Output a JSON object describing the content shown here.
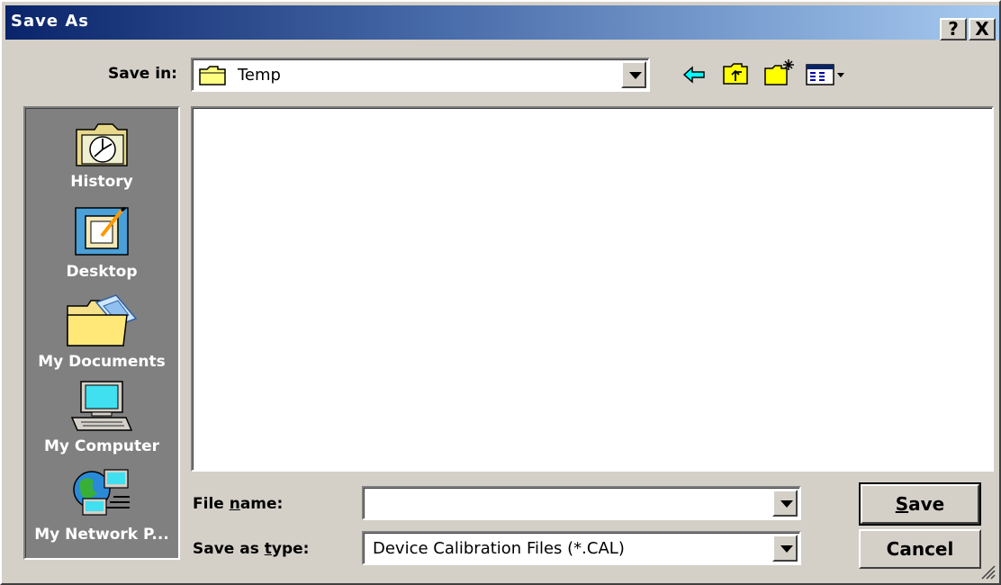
{
  "window": {
    "title": "Save As",
    "help_button": "?",
    "close_button": "X"
  },
  "save_in": {
    "label": "Save in:",
    "value": "Temp"
  },
  "toolbar": {
    "back_icon": "arrow-left-icon",
    "up_icon": "folder-up-icon",
    "new_folder_icon": "new-folder-icon",
    "view_icon": "view-menu-icon"
  },
  "places": [
    {
      "label": "History",
      "icon": "history-icon"
    },
    {
      "label": "Desktop",
      "icon": "desktop-icon"
    },
    {
      "label": "My Documents",
      "icon": "my-documents-icon"
    },
    {
      "label": "My Computer",
      "icon": "my-computer-icon"
    },
    {
      "label": "My Network P...",
      "icon": "my-network-places-icon"
    }
  ],
  "file_name": {
    "label_prefix": "File ",
    "label_accel": "n",
    "label_suffix": "ame:",
    "value": ""
  },
  "save_as_type": {
    "label_prefix": "Save as ",
    "label_accel": "t",
    "label_suffix": "ype:",
    "value": "Device Calibration Files (*.CAL)"
  },
  "buttons": {
    "save_accel": "S",
    "save_rest": "ave",
    "cancel": "Cancel"
  },
  "colors": {
    "title_start": "#0a246a",
    "title_end": "#a6caf0",
    "face": "#d4d0c8",
    "places_bg": "#808080"
  }
}
